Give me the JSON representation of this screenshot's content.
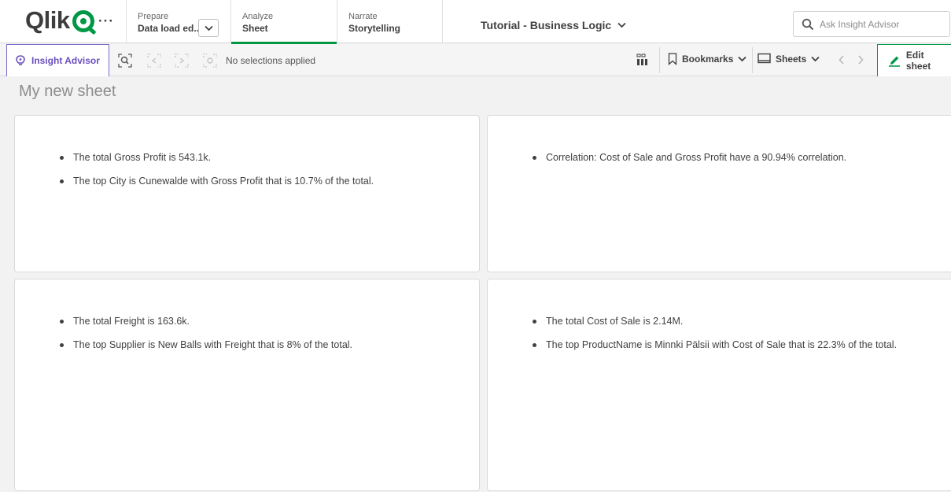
{
  "brand": {
    "name": "Qlik",
    "accent": "#009845",
    "insight_color": "#6b4fbf"
  },
  "nav": {
    "more_label": "···",
    "tabs": [
      {
        "small": "Prepare",
        "big": "Data load ed..."
      },
      {
        "small": "Analyze",
        "big": "Sheet"
      },
      {
        "small": "Narrate",
        "big": "Storytelling"
      }
    ],
    "app_title": "Tutorial - Business Logic",
    "search_placeholder": "Ask Insight Advisor"
  },
  "toolbar": {
    "insight_label": "Insight Advisor",
    "selection_status": "No selections applied",
    "bookmarks_label": "Bookmarks",
    "sheets_label": "Sheets",
    "edit_label": "Edit sheet"
  },
  "sheet": {
    "title": "My new sheet",
    "cards": [
      {
        "bullets": [
          "The total Gross Profit is 543.1k.",
          "The top City is Cunewalde with Gross Profit that is 10.7% of the total."
        ]
      },
      {
        "bullets": [
          "Correlation: Cost of Sale and Gross Profit have a 90.94% correlation."
        ]
      },
      {
        "bullets": [
          "The total Freight is 163.6k.",
          "The top Supplier is New Balls with Freight that is 8% of the total."
        ]
      },
      {
        "bullets": [
          "The total Cost of Sale is 2.14M.",
          "The top ProductName is Minnki Pälsii with Cost of Sale that is 22.3% of the total."
        ]
      }
    ]
  }
}
